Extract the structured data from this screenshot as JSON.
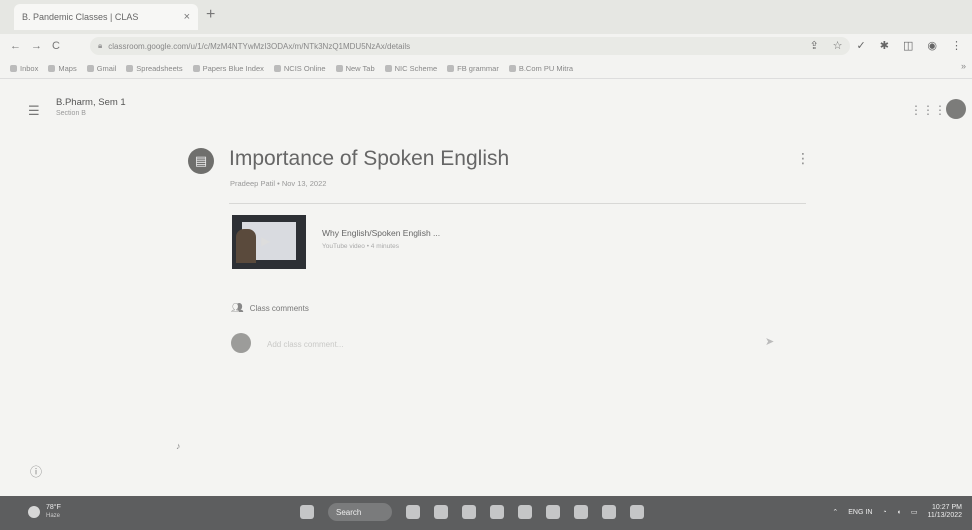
{
  "browser": {
    "tab_title": "B. Pandemic Classes | CLAS",
    "tab_close": "×",
    "new_tab": "+",
    "back": "←",
    "forward": "→",
    "reload": "C",
    "url": "classroom.google.com/u/1/c/MzM4NTYwMzI3ODAx/m/NTk3NzQ1MDU5NzAx/details",
    "bookmarks": [
      "Inbox",
      "Maps",
      "Gmail",
      "Spreadsheets",
      "Papers Blue Index",
      "NCIS Online",
      "New Tab",
      "NIC Scheme",
      "FB grammar",
      "B.Com PU Mitra"
    ],
    "bookmarks_more": "»"
  },
  "classroom": {
    "class_name": "B.Pharm, Sem 1",
    "class_section": "Section B"
  },
  "material": {
    "icon": "▤",
    "title": "Importance of Spoken English",
    "meta": "Pradeep Patil • Nov 13, 2022",
    "more": "⋮",
    "attachment": {
      "title": "Why English/Spoken English ...",
      "subtitle": "YouTube video • 4 minutes"
    }
  },
  "comments": {
    "label": "Class comments",
    "placeholder": "Add class comment...",
    "send": "➤"
  },
  "misc": {
    "stray_mark": "♪",
    "help": "ⓘ"
  },
  "taskbar": {
    "weather_temp": "78°F",
    "weather_cond": "Haze",
    "search_label": "Search",
    "tray_lang": "ENG IN",
    "time": "10:27 PM",
    "date": "11/13/2022"
  },
  "colors": {
    "page_bg": "#f4f4f2",
    "taskbar_bg": "#5d5e5f",
    "title_text": "#666666"
  }
}
